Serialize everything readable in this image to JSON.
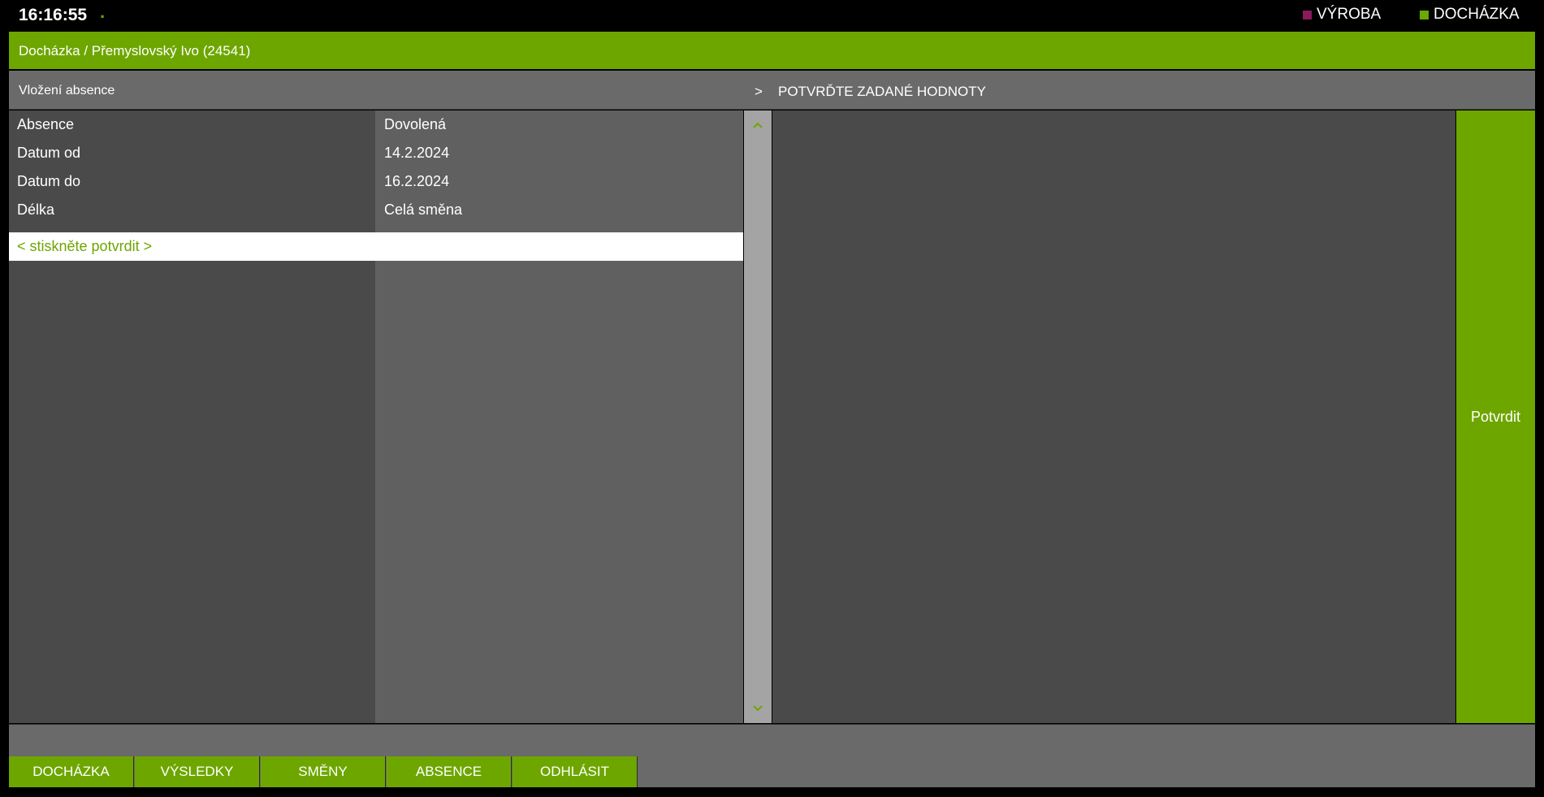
{
  "header": {
    "clock": "16:16:55",
    "clock_dot": ".",
    "modes": [
      {
        "label": "VÝROBA",
        "color": "#8a1a5a"
      },
      {
        "label": "DOCHÁZKA",
        "color": "#6ea600"
      }
    ]
  },
  "breadcrumb": "Docházka / Přemyslovský Ivo (24541)",
  "section": {
    "title": "Vložení absence",
    "arrow": ">",
    "prompt": "POTVRĎTE ZADANÉ HODNOTY"
  },
  "form": {
    "rows": [
      {
        "label": "Absence",
        "value": "Dovolená"
      },
      {
        "label": "Datum od",
        "value": "14.2.2024"
      },
      {
        "label": "Datum do",
        "value": "16.2.2024"
      },
      {
        "label": "Délka",
        "value": "Celá směna"
      }
    ],
    "active_row": "< stiskněte potvrdit >"
  },
  "confirm_button": "Potvrdit",
  "nav": [
    "DOCHÁZKA",
    "VÝSLEDKY",
    "SMĚNY",
    "ABSENCE",
    "ODHLÁSIT"
  ],
  "colors": {
    "accent": "#6ea600",
    "vyroba": "#8a1a5a"
  }
}
